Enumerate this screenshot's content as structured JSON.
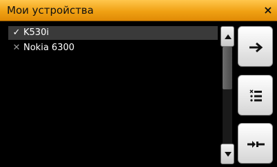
{
  "window": {
    "title": "Мои устройства",
    "close_glyph": "×"
  },
  "devices": [
    {
      "name": "K530i",
      "status_icon": "check-icon",
      "selected": true
    },
    {
      "name": "Nokia 6300",
      "status_icon": "cross-icon",
      "selected": false
    }
  ],
  "scrollbar": {
    "up_icon": "triangle-up-icon",
    "down_icon": "triangle-down-icon"
  },
  "actions": [
    {
      "icon": "arrow-right-icon"
    },
    {
      "icon": "list-delete-icon"
    },
    {
      "icon": "connect-plug-icon"
    }
  ]
}
